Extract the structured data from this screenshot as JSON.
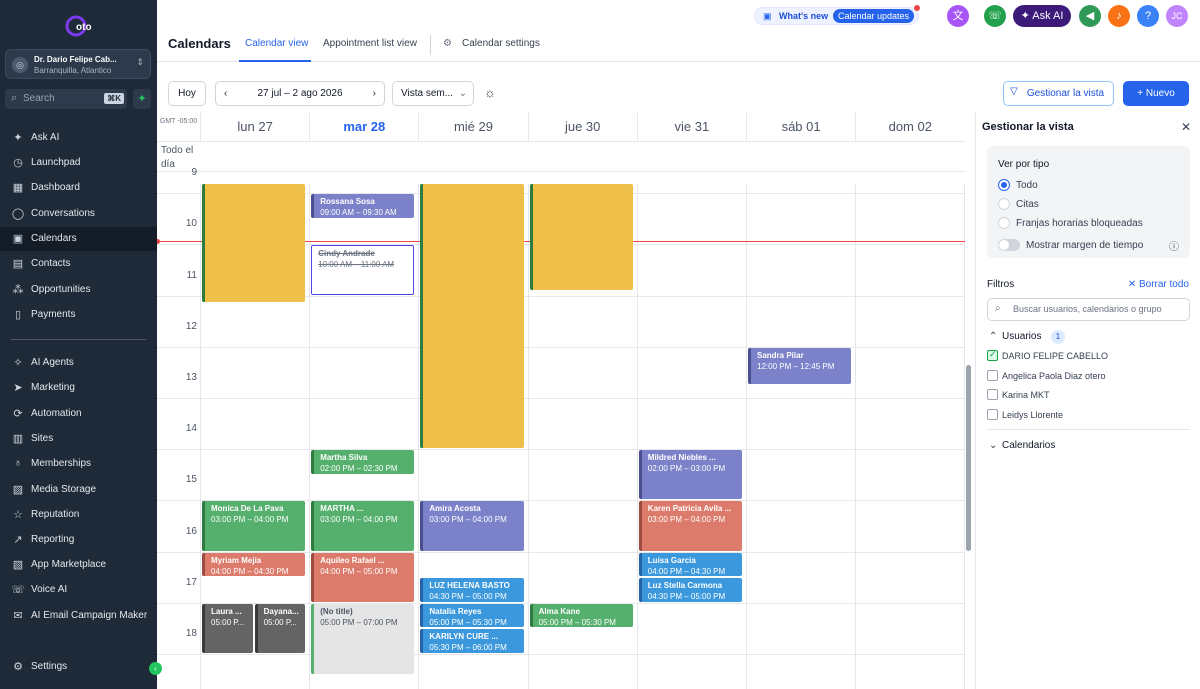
{
  "brand": {
    "logo_text": "oto"
  },
  "account": {
    "name": "Dr. Dario Felipe Cab...",
    "location": "Barranquilla, Atlantico",
    "avatar_initial": "◎"
  },
  "search": {
    "placeholder": "Search",
    "shortcut": "⌘K"
  },
  "sidebar": {
    "items": [
      {
        "label": "Ask AI",
        "icon": "sparkle-icon",
        "glyph": "✦"
      },
      {
        "label": "Launchpad",
        "icon": "rocket-icon",
        "glyph": "◷"
      },
      {
        "label": "Dashboard",
        "icon": "grid-icon",
        "glyph": "▦"
      },
      {
        "label": "Conversations",
        "icon": "chat-icon",
        "glyph": "◯"
      },
      {
        "label": "Calendars",
        "icon": "calendar-icon",
        "glyph": "▣"
      },
      {
        "label": "Contacts",
        "icon": "contacts-icon",
        "glyph": "▤"
      },
      {
        "label": "Opportunities",
        "icon": "opportunities-icon",
        "glyph": "⁂"
      },
      {
        "label": "Payments",
        "icon": "payments-icon",
        "glyph": "▯"
      },
      {
        "label": "AI Agents",
        "icon": "ai-agents-icon",
        "glyph": "✧"
      },
      {
        "label": "Marketing",
        "icon": "send-icon",
        "glyph": "➤"
      },
      {
        "label": "Automation",
        "icon": "automation-icon",
        "glyph": "⟳"
      },
      {
        "label": "Sites",
        "icon": "sites-icon",
        "glyph": "▥"
      },
      {
        "label": "Memberships",
        "icon": "memberships-icon",
        "glyph": "♁"
      },
      {
        "label": "Media Storage",
        "icon": "media-icon",
        "glyph": "▨"
      },
      {
        "label": "Reputation",
        "icon": "star-icon",
        "glyph": "☆"
      },
      {
        "label": "Reporting",
        "icon": "reporting-icon",
        "glyph": "↗"
      },
      {
        "label": "App Marketplace",
        "icon": "marketplace-icon",
        "glyph": "▧"
      },
      {
        "label": "Voice AI",
        "icon": "voice-icon",
        "glyph": "☏"
      },
      {
        "label": "AI Email Campaign Maker",
        "icon": "email-icon",
        "glyph": "✉"
      },
      {
        "label": "Settings",
        "icon": "gear-icon",
        "glyph": "⚙"
      }
    ]
  },
  "header": {
    "title": "Calendars",
    "tabs": [
      "Calendar view",
      "Appointment list view",
      "Calendar settings"
    ],
    "whats_new": "What's new",
    "updates_badge": "Calendar updates",
    "ask_ai": "✦ Ask AI",
    "user_initials": "JC",
    "help": "?"
  },
  "toolbar": {
    "today": "Hoy",
    "range": "27 jul – 2 ago 2026",
    "view": "Vista sem...",
    "manage": "Gestionar la vista",
    "new": "+ Nuevo"
  },
  "calendar": {
    "timezone": "GMT -05:00",
    "all_day_label": "Todo el día",
    "days": [
      "lun 27",
      "mar 28",
      "mié 29",
      "jue 30",
      "vie 31",
      "sáb 01",
      "dom 02"
    ],
    "today_index": 1,
    "hours": [
      "9",
      "10",
      "11",
      "12",
      "13",
      "14",
      "15",
      "16",
      "17",
      "18"
    ],
    "first_hour": 8.8,
    "now_hour": 9.93,
    "colors": {
      "yellow": "#eec04a",
      "purple": "#7b82c9",
      "green": "#55b06e",
      "red": "#dc7b6b",
      "blue": "#3b98dc",
      "gray": "#646464",
      "light": "#e5e5e5"
    },
    "events": [
      {
        "day": 0,
        "start": 8.8,
        "end": 11.15,
        "color": "yellow",
        "title": "",
        "time": ""
      },
      {
        "day": 2,
        "start": 8.8,
        "end": 14.0,
        "color": "yellow",
        "title": "",
        "time": ""
      },
      {
        "day": 3,
        "start": 8.8,
        "end": 10.9,
        "color": "yellow",
        "title": "",
        "time": ""
      },
      {
        "day": 1,
        "start": 9.0,
        "end": 9.5,
        "color": "purple",
        "title": "Rossana Sosa",
        "time": "09:00 AM – 09:30 AM"
      },
      {
        "day": 1,
        "start": 10.0,
        "end": 11.0,
        "color": "cancel",
        "title": "Cindy Andrade",
        "time": "10:00 AM – 11:00 AM"
      },
      {
        "day": 5,
        "start": 12.0,
        "end": 12.75,
        "color": "purple",
        "title": "Sandra Pilar",
        "time": "12:00 PM – 12:45 PM"
      },
      {
        "day": 1,
        "start": 14.0,
        "end": 14.5,
        "color": "green",
        "title": "Martha Silva",
        "time": "02:00 PM – 02:30 PM"
      },
      {
        "day": 4,
        "start": 14.0,
        "end": 15.0,
        "color": "purple",
        "title": "Mildred Niebles ...",
        "time": "02:00 PM – 03:00 PM"
      },
      {
        "day": 0,
        "start": 15.0,
        "end": 16.0,
        "color": "green",
        "title": "Monica De La Pava",
        "time": "03:00 PM – 04:00 PM"
      },
      {
        "day": 1,
        "start": 15.0,
        "end": 16.0,
        "color": "green",
        "title": "MARTHA ...",
        "time": "03:00 PM – 04:00 PM"
      },
      {
        "day": 2,
        "start": 15.0,
        "end": 16.0,
        "color": "purple",
        "title": "Amira Acosta",
        "time": "03:00 PM – 04:00 PM"
      },
      {
        "day": 4,
        "start": 15.0,
        "end": 16.0,
        "color": "red",
        "title": "Karen Patricia Avila ...",
        "time": "03:00 PM – 04:00 PM"
      },
      {
        "day": 0,
        "start": 16.0,
        "end": 16.5,
        "color": "red",
        "title": "Myriam Mejia",
        "time": "04:00 PM – 04:30 PM"
      },
      {
        "day": 1,
        "start": 16.0,
        "end": 17.0,
        "color": "red",
        "title": "Aquileo Rafael ...",
        "time": "04:00 PM – 05:00 PM"
      },
      {
        "day": 4,
        "start": 16.0,
        "end": 16.5,
        "color": "blue",
        "title": "Luisa Garcia",
        "time": "04:00 PM – 04:30 PM"
      },
      {
        "day": 2,
        "start": 16.5,
        "end": 17.0,
        "color": "blue",
        "title": "LUZ HELENA BASTO",
        "time": "04:30 PM – 05:00 PM"
      },
      {
        "day": 4,
        "start": 16.5,
        "end": 17.0,
        "color": "blue",
        "title": "Luz Stella Carmona",
        "time": "04:30 PM – 05:00 PM"
      },
      {
        "day": 0,
        "start": 17.0,
        "end": 18.0,
        "color": "gray",
        "title": "Laura ...",
        "time": "05:00 P...",
        "half": 0
      },
      {
        "day": 0,
        "start": 17.0,
        "end": 18.0,
        "color": "gray",
        "title": "Dayana...",
        "time": "05:00 P...",
        "half": 1
      },
      {
        "day": 1,
        "start": 17.0,
        "end": 18.4,
        "color": "light",
        "title": "(No title)",
        "time": "05:00 PM – 07:00 PM"
      },
      {
        "day": 2,
        "start": 17.0,
        "end": 17.5,
        "color": "blue",
        "title": "Natalia Reyes",
        "time": "05:00 PM – 05:30 PM"
      },
      {
        "day": 3,
        "start": 17.0,
        "end": 17.5,
        "color": "green",
        "title": "Alma Kane",
        "time": "05:00 PM – 05:30 PM"
      },
      {
        "day": 2,
        "start": 17.5,
        "end": 18.0,
        "color": "blue",
        "title": "KARILYN CURE ...",
        "time": "05:30 PM – 06:00 PM"
      }
    ]
  },
  "panel": {
    "title": "Gestionar la vista",
    "type_heading": "Ver por tipo",
    "types": [
      "Todo",
      "Citas",
      "Franjas horarias bloqueadas"
    ],
    "selected_type": 0,
    "toggle_label": "Mostrar margen de tiempo",
    "filters_label": "Filtros",
    "clear_all": "✕ Borrar todo",
    "filter_placeholder": "Buscar usuarios, calendarios o grupo",
    "users_label": "Usuarios",
    "users_count": "1",
    "users": [
      {
        "name": "DARIO FELIPE CABELLO",
        "checked": true
      },
      {
        "name": "Angelica Paola Diaz otero",
        "checked": false
      },
      {
        "name": "Karina MKT",
        "checked": false
      },
      {
        "name": "Leidys Llorente",
        "checked": false
      }
    ],
    "calendars_label": "Calendarios"
  }
}
